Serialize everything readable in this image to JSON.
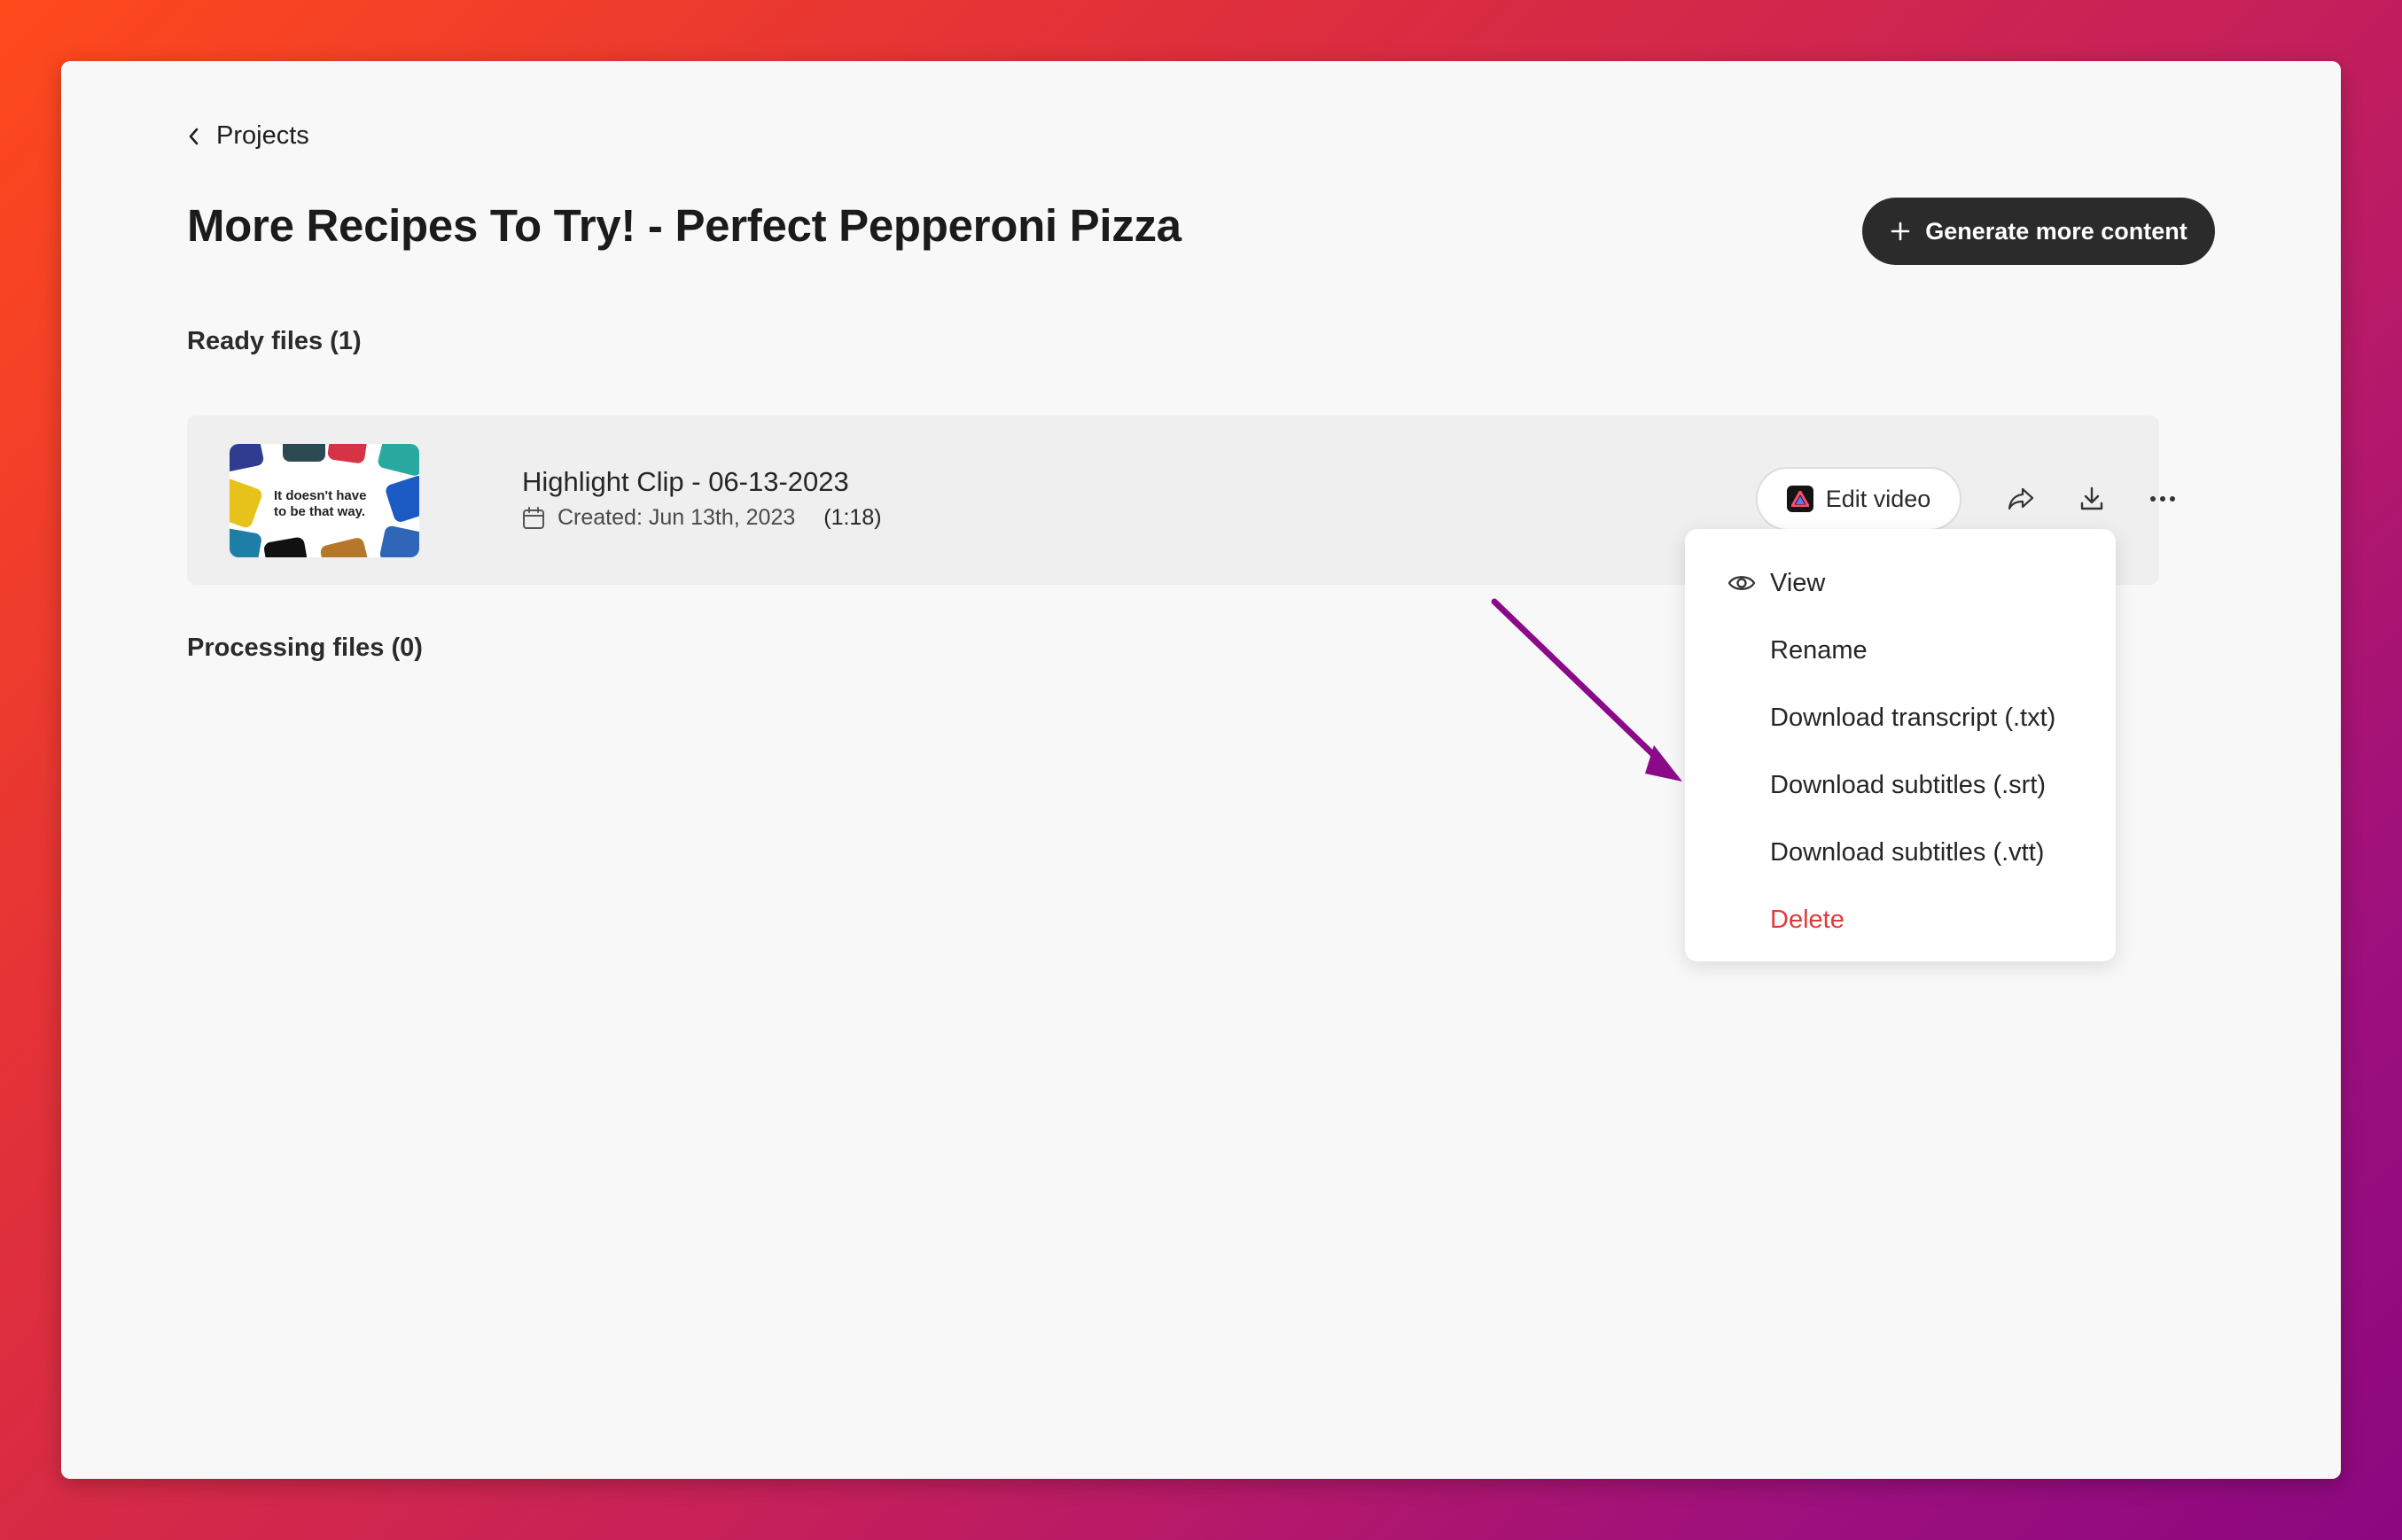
{
  "breadcrumb": {
    "label": "Projects",
    "icon": "chevron-left-icon"
  },
  "page": {
    "title": "More Recipes To Try! - Perfect Pepperoni Pizza"
  },
  "header": {
    "generate_button_label": "Generate more content",
    "generate_button_icon": "plus-icon"
  },
  "sections": {
    "ready_heading": "Ready files (1)",
    "processing_heading": "Processing files (0)"
  },
  "files": [
    {
      "thumbnail_text": "It doesn't have to be that way.",
      "title": "Highlight Clip - 06-13-2023",
      "created": "Created: Jun 13th, 2023",
      "duration": "(1:18)",
      "edit_button_label": "Edit video"
    }
  ],
  "actions": {
    "share_icon": "share-icon",
    "download_icon": "download-icon",
    "more_icon": "more-options-icon"
  },
  "menu": {
    "items": [
      {
        "label": "View",
        "icon": "eye-icon"
      },
      {
        "label": "Rename"
      },
      {
        "label": "Download transcript (.txt)"
      },
      {
        "label": "Download subtitles (.srt)"
      },
      {
        "label": "Download subtitles (.vtt)"
      },
      {
        "label": "Delete",
        "danger": true
      }
    ]
  },
  "colors": {
    "accent_dark": "#2b2b2b",
    "danger": "#e5383b",
    "annotation_arrow": "#8b0a8a"
  }
}
